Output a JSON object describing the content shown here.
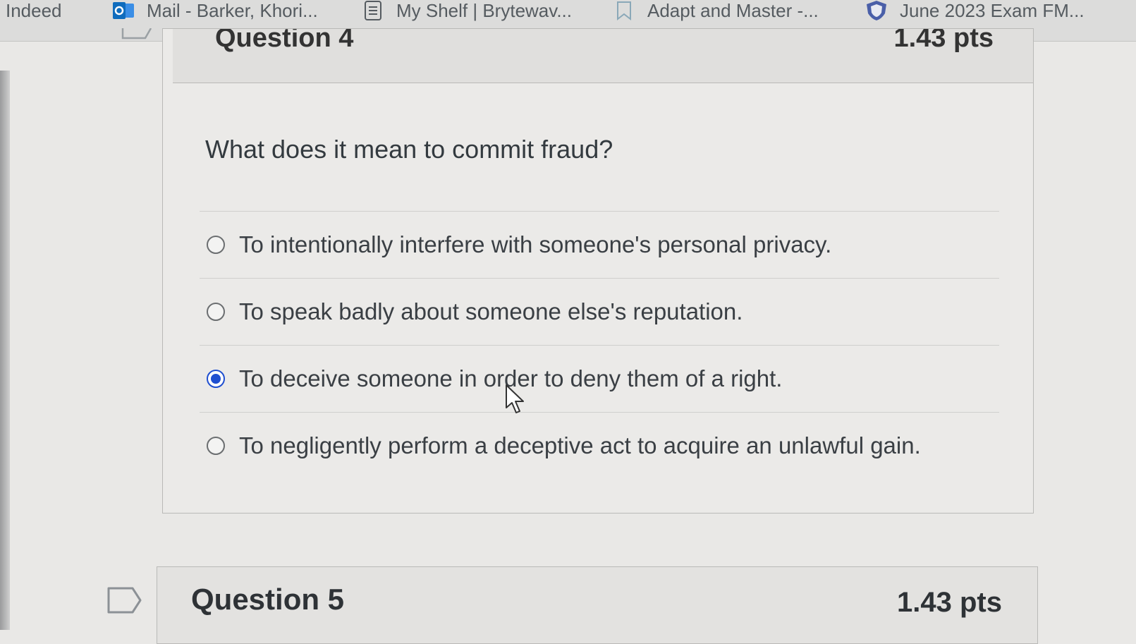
{
  "bookmarks": [
    {
      "label": "| Indeed",
      "icon": "indeed-icon"
    },
    {
      "label": "Mail - Barker, Khori...",
      "icon": "outlook-icon"
    },
    {
      "label": "My Shelf | Brytewav...",
      "icon": "document-icon"
    },
    {
      "label": "Adapt and Master -...",
      "icon": "bookmark-icon"
    },
    {
      "label": "June 2023 Exam FM...",
      "icon": "shield-icon"
    }
  ],
  "question4": {
    "title": "Question 4",
    "points": "1.43 pts",
    "text": "What does it mean to commit fraud?",
    "answers": [
      {
        "label": "To intentionally interfere with someone's personal privacy.",
        "selected": false
      },
      {
        "label": "To speak badly about someone else's reputation.",
        "selected": false
      },
      {
        "label": "To deceive someone in order to deny them of a right.",
        "selected": true
      },
      {
        "label": "To negligently perform a deceptive act to acquire an unlawful gain.",
        "selected": false
      }
    ]
  },
  "question5": {
    "title": "Question 5",
    "points": "1.43 pts"
  },
  "colors": {
    "radio_selected": "#1f4fd0",
    "outlook_blue": "#0f6cbd"
  }
}
